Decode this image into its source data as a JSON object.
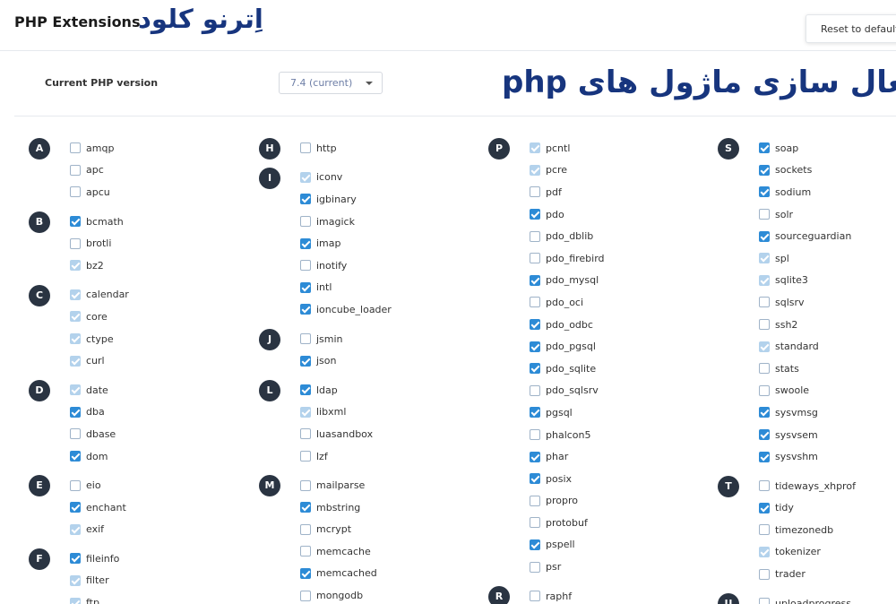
{
  "header": {
    "title": "PHP Extensions",
    "brand": "اِترنو کلود",
    "reset_label": "Reset to default"
  },
  "version": {
    "label": "Current PHP version",
    "selected": "7.4 (current)"
  },
  "banner": "فعال سازی ماژول های php",
  "columns": [
    [
      {
        "letter": "A",
        "items": [
          {
            "name": "amqp",
            "state": "unchecked"
          },
          {
            "name": "apc",
            "state": "unchecked"
          },
          {
            "name": "apcu",
            "state": "unchecked"
          }
        ]
      },
      {
        "letter": "B",
        "items": [
          {
            "name": "bcmath",
            "state": "checked"
          },
          {
            "name": "brotli",
            "state": "unchecked"
          },
          {
            "name": "bz2",
            "state": "disabled"
          }
        ]
      },
      {
        "letter": "C",
        "items": [
          {
            "name": "calendar",
            "state": "disabled"
          },
          {
            "name": "core",
            "state": "disabled"
          },
          {
            "name": "ctype",
            "state": "disabled"
          },
          {
            "name": "curl",
            "state": "disabled"
          }
        ]
      },
      {
        "letter": "D",
        "items": [
          {
            "name": "date",
            "state": "disabled"
          },
          {
            "name": "dba",
            "state": "checked"
          },
          {
            "name": "dbase",
            "state": "unchecked"
          },
          {
            "name": "dom",
            "state": "checked"
          }
        ]
      },
      {
        "letter": "E",
        "items": [
          {
            "name": "eio",
            "state": "unchecked"
          },
          {
            "name": "enchant",
            "state": "checked"
          },
          {
            "name": "exif",
            "state": "disabled"
          }
        ]
      },
      {
        "letter": "F",
        "items": [
          {
            "name": "fileinfo",
            "state": "checked"
          },
          {
            "name": "filter",
            "state": "disabled"
          },
          {
            "name": "ftp",
            "state": "disabled"
          }
        ]
      }
    ],
    [
      {
        "letter": "H",
        "items": [
          {
            "name": "http",
            "state": "unchecked"
          }
        ]
      },
      {
        "letter": "I",
        "items": [
          {
            "name": "iconv",
            "state": "disabled"
          },
          {
            "name": "igbinary",
            "state": "checked"
          },
          {
            "name": "imagick",
            "state": "unchecked"
          },
          {
            "name": "imap",
            "state": "checked"
          },
          {
            "name": "inotify",
            "state": "unchecked"
          },
          {
            "name": "intl",
            "state": "checked"
          },
          {
            "name": "ioncube_loader",
            "state": "checked"
          }
        ]
      },
      {
        "letter": "J",
        "items": [
          {
            "name": "jsmin",
            "state": "unchecked"
          },
          {
            "name": "json",
            "state": "checked"
          }
        ]
      },
      {
        "letter": "L",
        "items": [
          {
            "name": "ldap",
            "state": "checked"
          },
          {
            "name": "libxml",
            "state": "disabled"
          },
          {
            "name": "luasandbox",
            "state": "unchecked"
          },
          {
            "name": "lzf",
            "state": "unchecked"
          }
        ]
      },
      {
        "letter": "M",
        "items": [
          {
            "name": "mailparse",
            "state": "unchecked"
          },
          {
            "name": "mbstring",
            "state": "checked"
          },
          {
            "name": "mcrypt",
            "state": "unchecked"
          },
          {
            "name": "memcache",
            "state": "unchecked"
          },
          {
            "name": "memcached",
            "state": "checked"
          },
          {
            "name": "mongodb",
            "state": "unchecked"
          }
        ]
      }
    ],
    [
      {
        "letter": "P",
        "items": [
          {
            "name": "pcntl",
            "state": "disabled"
          },
          {
            "name": "pcre",
            "state": "disabled"
          },
          {
            "name": "pdf",
            "state": "unchecked"
          },
          {
            "name": "pdo",
            "state": "checked"
          },
          {
            "name": "pdo_dblib",
            "state": "unchecked"
          },
          {
            "name": "pdo_firebird",
            "state": "unchecked"
          },
          {
            "name": "pdo_mysql",
            "state": "checked"
          },
          {
            "name": "pdo_oci",
            "state": "unchecked"
          },
          {
            "name": "pdo_odbc",
            "state": "checked"
          },
          {
            "name": "pdo_pgsql",
            "state": "checked"
          },
          {
            "name": "pdo_sqlite",
            "state": "checked"
          },
          {
            "name": "pdo_sqlsrv",
            "state": "unchecked"
          },
          {
            "name": "pgsql",
            "state": "checked"
          },
          {
            "name": "phalcon5",
            "state": "unchecked"
          },
          {
            "name": "phar",
            "state": "checked"
          },
          {
            "name": "posix",
            "state": "checked"
          },
          {
            "name": "propro",
            "state": "unchecked"
          },
          {
            "name": "protobuf",
            "state": "unchecked"
          },
          {
            "name": "pspell",
            "state": "checked"
          },
          {
            "name": "psr",
            "state": "unchecked"
          }
        ]
      },
      {
        "letter": "R",
        "items": [
          {
            "name": "raphf",
            "state": "unchecked"
          }
        ]
      }
    ],
    [
      {
        "letter": "S",
        "items": [
          {
            "name": "soap",
            "state": "checked"
          },
          {
            "name": "sockets",
            "state": "checked"
          },
          {
            "name": "sodium",
            "state": "checked"
          },
          {
            "name": "solr",
            "state": "unchecked"
          },
          {
            "name": "sourceguardian",
            "state": "checked"
          },
          {
            "name": "spl",
            "state": "disabled"
          },
          {
            "name": "sqlite3",
            "state": "disabled"
          },
          {
            "name": "sqlsrv",
            "state": "unchecked"
          },
          {
            "name": "ssh2",
            "state": "unchecked"
          },
          {
            "name": "standard",
            "state": "disabled"
          },
          {
            "name": "stats",
            "state": "unchecked"
          },
          {
            "name": "swoole",
            "state": "unchecked"
          },
          {
            "name": "sysvmsg",
            "state": "checked"
          },
          {
            "name": "sysvsem",
            "state": "checked"
          },
          {
            "name": "sysvshm",
            "state": "checked"
          }
        ]
      },
      {
        "letter": "T",
        "items": [
          {
            "name": "tideways_xhprof",
            "state": "unchecked"
          },
          {
            "name": "tidy",
            "state": "checked"
          },
          {
            "name": "timezonedb",
            "state": "unchecked"
          },
          {
            "name": "tokenizer",
            "state": "disabled"
          },
          {
            "name": "trader",
            "state": "unchecked"
          }
        ]
      },
      {
        "letter": "U",
        "items": [
          {
            "name": "uploadprogress",
            "state": "unchecked"
          }
        ]
      }
    ]
  ]
}
